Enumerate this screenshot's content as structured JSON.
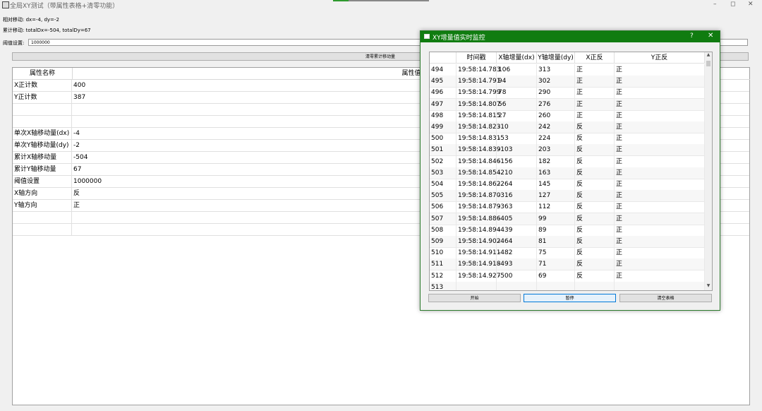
{
  "window": {
    "title": "全局XY测试（带属性表格+清零功能）",
    "controls": [
      "–",
      "◻",
      "✕"
    ]
  },
  "info": {
    "relative_move": "相对移动: dx=-4, dy=-2",
    "total_move": "累计移动: totalDx=-504, totalDy=67"
  },
  "threshold": {
    "label": "阈值设置:",
    "value": "1000000"
  },
  "clear_button": "清零累计移动量",
  "properties": {
    "headers": [
      "属性名称",
      "属性值"
    ],
    "rows": [
      {
        "name": "X正计数",
        "value": "400"
      },
      {
        "name": "Y正计数",
        "value": "387"
      },
      {
        "name": "",
        "value": ""
      },
      {
        "name": "",
        "value": ""
      },
      {
        "name": "单次X轴移动量(dx)",
        "value": "-4"
      },
      {
        "name": "单次Y轴移动量(dy)",
        "value": "-2"
      },
      {
        "name": "累计X轴移动量",
        "value": "-504"
      },
      {
        "name": "累计Y轴移动量",
        "value": "67"
      },
      {
        "name": "阈值设置",
        "value": "1000000"
      },
      {
        "name": "X轴方向",
        "value": "反"
      },
      {
        "name": "Y轴方向",
        "value": "正"
      },
      {
        "name": "",
        "value": ""
      },
      {
        "name": "",
        "value": ""
      }
    ]
  },
  "dialog": {
    "title": "XY增量值实时监控",
    "help": "?",
    "close": "✕",
    "headers": [
      "",
      "时间戳",
      "X轴增量(dx)",
      "Y轴增量(dy)",
      "X正反",
      "Y正反"
    ],
    "rows": [
      [
        "494",
        "19:58:14.783",
        "106",
        "313",
        "正",
        "正"
      ],
      [
        "495",
        "19:58:14.791",
        "94",
        "302",
        "正",
        "正"
      ],
      [
        "496",
        "19:58:14.799",
        "78",
        "290",
        "正",
        "正"
      ],
      [
        "497",
        "19:58:14.807",
        "56",
        "276",
        "正",
        "正"
      ],
      [
        "498",
        "19:58:14.815",
        "27",
        "260",
        "正",
        "正"
      ],
      [
        "499",
        "19:58:14.823",
        "-10",
        "242",
        "反",
        "正"
      ],
      [
        "500",
        "19:58:14.831",
        "-53",
        "224",
        "反",
        "正"
      ],
      [
        "501",
        "19:58:14.839",
        "-103",
        "203",
        "反",
        "正"
      ],
      [
        "502",
        "19:58:14.846",
        "-156",
        "182",
        "反",
        "正"
      ],
      [
        "503",
        "19:58:14.854",
        "-210",
        "163",
        "反",
        "正"
      ],
      [
        "504",
        "19:58:14.862",
        "-264",
        "145",
        "反",
        "正"
      ],
      [
        "505",
        "19:58:14.870",
        "-316",
        "127",
        "反",
        "正"
      ],
      [
        "506",
        "19:58:14.879",
        "-363",
        "112",
        "反",
        "正"
      ],
      [
        "507",
        "19:58:14.886",
        "-405",
        "99",
        "反",
        "正"
      ],
      [
        "508",
        "19:58:14.894",
        "-439",
        "89",
        "反",
        "正"
      ],
      [
        "509",
        "19:58:14.902",
        "-464",
        "81",
        "反",
        "正"
      ],
      [
        "510",
        "19:58:14.911",
        "-482",
        "75",
        "反",
        "正"
      ],
      [
        "511",
        "19:58:14.918",
        "-493",
        "71",
        "反",
        "正"
      ],
      [
        "512",
        "19:58:14.927",
        "-500",
        "69",
        "反",
        "正"
      ],
      [
        "513",
        "",
        "",
        "",
        "",
        ""
      ]
    ],
    "buttons": {
      "start": "开始",
      "pause": "暂停",
      "clear": "清空表格"
    }
  },
  "colors": {
    "dialog_title_bar": "#107c10",
    "accent": "#0078d7"
  }
}
